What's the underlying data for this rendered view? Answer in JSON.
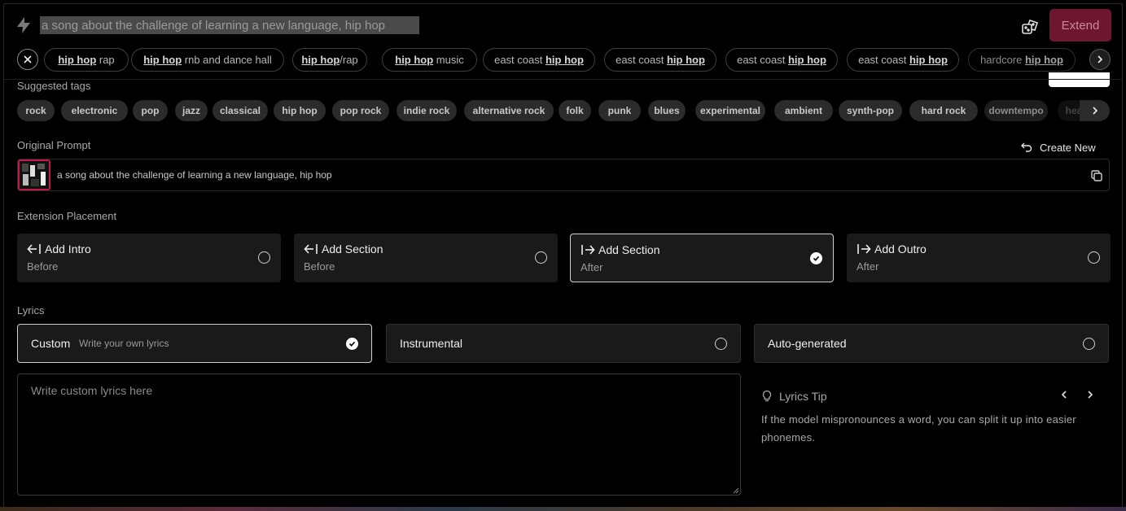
{
  "prompt": {
    "value": "a song about the challenge of learning a new language, hip hop"
  },
  "extend_button": {
    "label": "Extend"
  },
  "suggestions": [
    {
      "pre": "",
      "bold": "hip hop",
      "post": " rap"
    },
    {
      "pre": "",
      "bold": "hip hop",
      "post": " rnb and dance hall"
    },
    {
      "pre": "",
      "bold": "hip hop",
      "post": "/rap"
    },
    {
      "pre": "",
      "bold": "hip hop",
      "post": " music"
    },
    {
      "pre": "east coast ",
      "bold": "hip hop",
      "post": ""
    },
    {
      "pre": "east coast ",
      "bold": "hip hop",
      "post": ""
    },
    {
      "pre": "east coast ",
      "bold": "hip hop",
      "post": ""
    },
    {
      "pre": "east coast ",
      "bold": "hip hop",
      "post": ""
    },
    {
      "pre": "hardcore ",
      "bold": "hip hop",
      "post": ""
    }
  ],
  "suggested_tags": {
    "label": "Suggested tags",
    "tags": [
      "rock",
      "electronic",
      "pop",
      "jazz",
      "classical",
      "hip hop",
      "pop rock",
      "indie rock",
      "alternative rock",
      "folk",
      "punk",
      "blues",
      "experimental",
      "ambient",
      "synth-pop",
      "hard rock",
      "downtempo",
      "hea"
    ]
  },
  "original_prompt": {
    "label": "Original Prompt",
    "create_new": "Create New",
    "text": "a song about the challenge of learning a new language, hip hop"
  },
  "extension_placement": {
    "label": "Extension Placement",
    "options": [
      {
        "icon": "arrow-left-bar-icon",
        "title": "Add Intro",
        "sub": "Before",
        "selected": false
      },
      {
        "icon": "arrow-left-bar-icon",
        "title": "Add Section",
        "sub": "Before",
        "selected": false
      },
      {
        "icon": "bar-arrow-right-icon",
        "title": "Add Section",
        "sub": "After",
        "selected": true
      },
      {
        "icon": "bar-arrow-right-icon",
        "title": "Add Outro",
        "sub": "After",
        "selected": false
      }
    ]
  },
  "lyrics": {
    "label": "Lyrics",
    "options": [
      {
        "title": "Custom",
        "sub": "Write your own lyrics",
        "selected": true
      },
      {
        "title": "Instrumental",
        "sub": "",
        "selected": false
      },
      {
        "title": "Auto-generated",
        "sub": "",
        "selected": false
      }
    ],
    "placeholder": "Write custom lyrics here",
    "value": ""
  },
  "tip": {
    "title": "Lyrics Tip",
    "body": "If the model mispronounces a word, you can split it up into easier phonemes."
  },
  "colors": {
    "accent": "#6e1530",
    "accent_text": "#cc8a9e",
    "thumb_border": "#c0184a"
  }
}
